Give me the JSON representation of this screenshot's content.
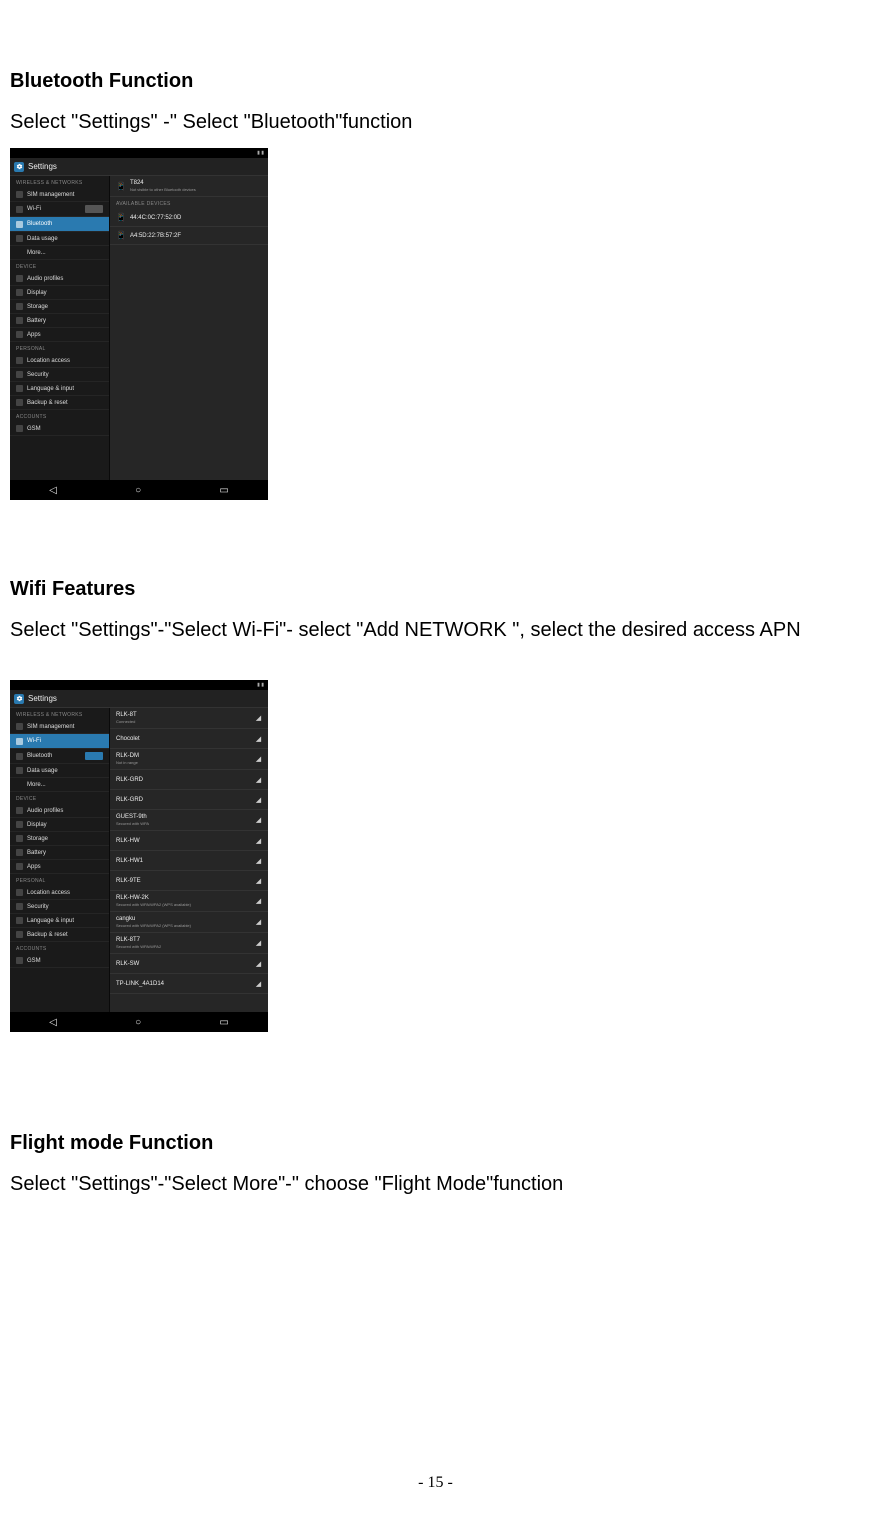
{
  "page_number": "- 15 -",
  "sections": {
    "bluetooth": {
      "heading": "Bluetooth Function",
      "text": "Select \"Settings\" -\" Select \"Bluetooth\"function"
    },
    "wifi": {
      "heading": "Wifi Features",
      "text": "Select \"Settings\"-\"Select Wi-Fi\"- select \"Add NETWORK \", select the desired access APN"
    },
    "flight": {
      "heading": "Flight mode Function",
      "text": "Select \"Settings\"-\"Select More\"-\" choose \"Flight Mode\"function"
    }
  },
  "screenshot_common": {
    "app_title": "Settings",
    "categories": {
      "wireless": "WIRELESS & NETWORKS",
      "device": "DEVICE",
      "personal": "PERSONAL",
      "accounts": "ACCOUNTS"
    },
    "sidebar": {
      "sim": "SIM management",
      "wifi": "Wi-Fi",
      "bluetooth": "Bluetooth",
      "data": "Data usage",
      "more": "More...",
      "audio": "Audio profiles",
      "display": "Display",
      "storage": "Storage",
      "battery": "Battery",
      "apps": "Apps",
      "location": "Location access",
      "security": "Security",
      "lang": "Language & input",
      "backup": "Backup & reset",
      "gsm": "GSM"
    }
  },
  "bt_screenshot": {
    "device_name": "T824",
    "device_sub": "Not visible to other Bluetooth devices",
    "paired_header": "AVAILABLE DEVICES",
    "dev1": "44:4C:0C:77:52:0D",
    "dev2": "A4:5D:22:7B:57:2F"
  },
  "wifi_screenshot": {
    "networks": [
      {
        "name": "RLK-8T",
        "sub": "Connected"
      },
      {
        "name": "Chocolet",
        "sub": ""
      },
      {
        "name": "RLK-DM",
        "sub": "Not in range"
      },
      {
        "name": "RLK-GRD",
        "sub": ""
      },
      {
        "name": "RLK-GRD",
        "sub": ""
      },
      {
        "name": "GUEST-9th",
        "sub": "Secured with WPA"
      },
      {
        "name": "RLK-HW",
        "sub": ""
      },
      {
        "name": "RLK-HW1",
        "sub": ""
      },
      {
        "name": "RLK-9TE",
        "sub": ""
      },
      {
        "name": "RLK-HW-2K",
        "sub": "Secured with WPA/WPA2 (WPS available)"
      },
      {
        "name": "cangku",
        "sub": "Secured with WPA/WPA2 (WPS available)"
      },
      {
        "name": "RLK-8T7",
        "sub": "Secured with WPA/WPA2"
      },
      {
        "name": "RLK-SW",
        "sub": ""
      },
      {
        "name": "TP-LINK_4A1D14",
        "sub": ""
      }
    ]
  }
}
